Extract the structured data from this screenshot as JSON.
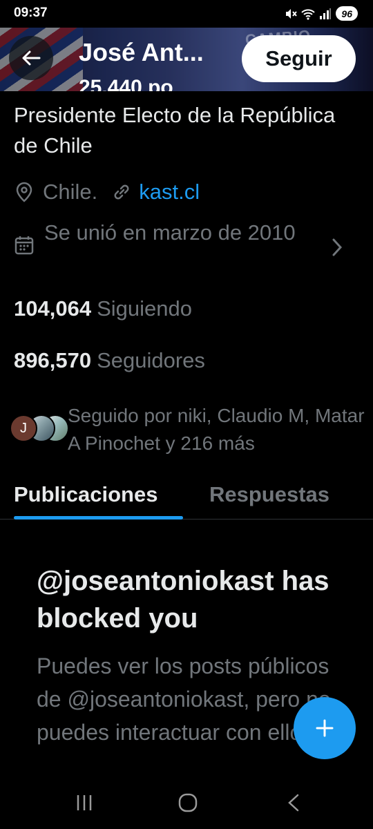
{
  "status_bar": {
    "time": "09:37",
    "battery": "96",
    "icons": [
      "mute-icon",
      "wifi-icon",
      "signal-icon",
      "battery-icon"
    ]
  },
  "header": {
    "name": "José Ant...",
    "subtitle_partial": "25.440 po",
    "banner_text": "CAMBIO",
    "follow_label": "Seguir"
  },
  "profile": {
    "bio": "Presidente Electo de la República de Chile",
    "location": "Chile.",
    "link": "kast.cl",
    "joined": "Se unió en marzo de 2010",
    "following_count": "104,064",
    "following_label": "Siguiendo",
    "followers_count": "896,570",
    "followers_label": "Seguidores",
    "avatar_initial": "J",
    "followed_by": "Seguido por niki, Claudio M, Matar A Pinochet y 216 más"
  },
  "tabs": [
    {
      "label": "Publicaciones",
      "active": true
    },
    {
      "label": "Respuestas",
      "active": false
    }
  ],
  "blocked": {
    "title": "@joseantoniokast has blocked you",
    "body": "Puedes ver los posts públicos de @joseantoniokast, pero no puedes interactuar con ellos."
  },
  "colors": {
    "accent": "#1d9bf0",
    "background": "#000000",
    "text_primary": "#e7e9ea",
    "text_secondary": "#71767b"
  }
}
